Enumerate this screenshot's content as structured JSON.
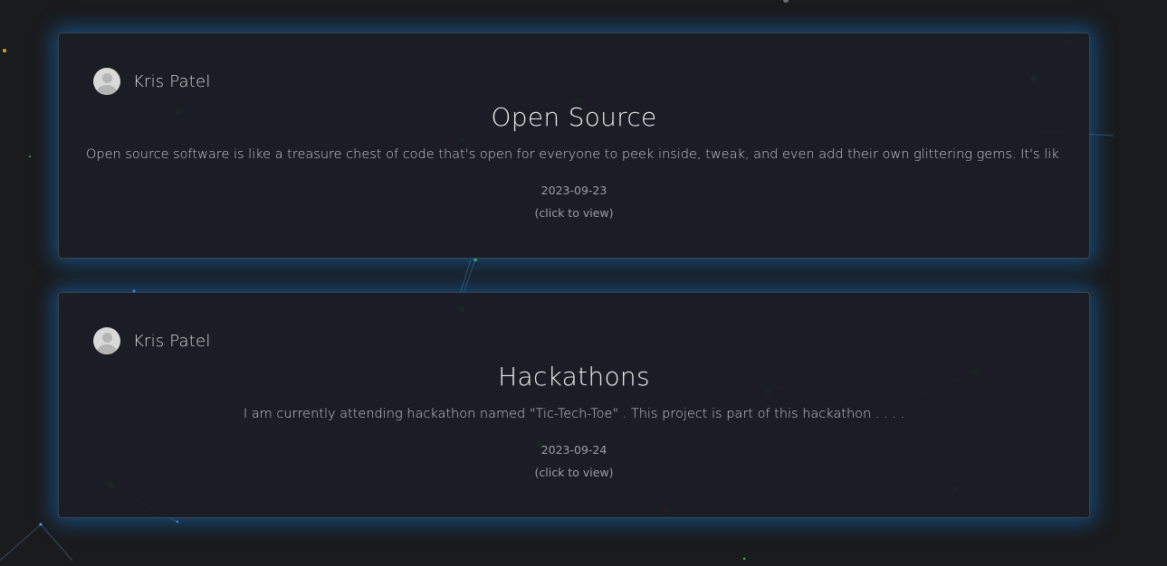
{
  "posts": [
    {
      "author": "Kris Patel",
      "title": "Open Source",
      "excerpt": "Open source software is like a treasure chest of code that's open for everyone to peek inside, tweak, and even add their own glittering gems. It's lik . . .",
      "date": "2023-09-23",
      "view_hint": "(click to view)"
    },
    {
      "author": "Kris Patel",
      "title": "Hackathons",
      "excerpt": "I am currently attending hackathon named \"Tic-Tech-Toe\" . This project is part of this hackathon . . . .",
      "date": "2023-09-24",
      "view_hint": "(click to view)"
    }
  ],
  "colors": {
    "background": "#1a1b1d",
    "card": "#1a1d24",
    "glow": "#146ebe",
    "particle_green": "#2ecc40",
    "particle_blue": "#4aa8ff"
  }
}
